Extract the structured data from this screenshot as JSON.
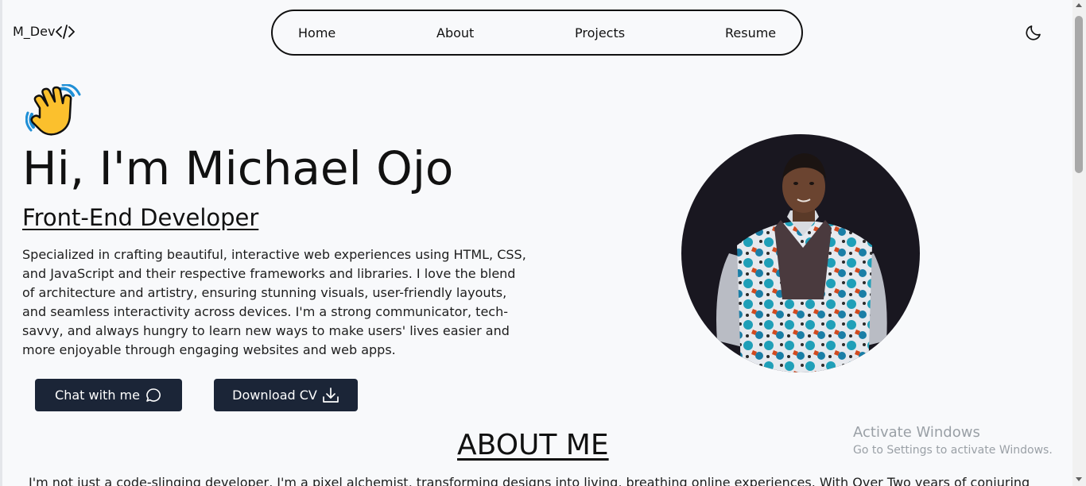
{
  "header": {
    "logo_text": "M_Dev",
    "logo_icon": "code-icon",
    "nav": [
      {
        "label": "Home"
      },
      {
        "label": "About"
      },
      {
        "label": "Projects"
      },
      {
        "label": "Resume"
      }
    ],
    "theme_toggle_icon": "moon-icon"
  },
  "hero": {
    "emoji": "waving-hand",
    "title": "Hi, I'm Michael Ojo",
    "subtitle": "Front-End Developer",
    "description": "Specialized in crafting beautiful, interactive web experiences using HTML, CSS, and JavaScript and their respective frameworks and libraries. I love the blend of architecture and artistry, ensuring stunning visuals, user-friendly layouts, and seamless interactivity across devices. I'm a strong communicator, tech-savvy, and always hungry to learn new ways to make users' lives easier and more enjoyable through engaging websites and web apps.",
    "buttons": {
      "chat_label": "Chat with me",
      "chat_icon": "chat-bubble-icon",
      "cv_label": "Download CV",
      "cv_icon": "download-icon"
    },
    "photo": "profile-photo"
  },
  "about": {
    "title": "ABOUT ME",
    "text": "I'm not just a code-slinging developer, I'm a pixel alchemist, transforming designs into living, breathing online experiences. With Over Two years of conjuring"
  },
  "watermark": {
    "line1": "Activate Windows",
    "line2": "Go to Settings to activate Windows."
  },
  "colors": {
    "background": "#f8f9fb",
    "button_bg": "#1b2537",
    "text": "#111111"
  }
}
